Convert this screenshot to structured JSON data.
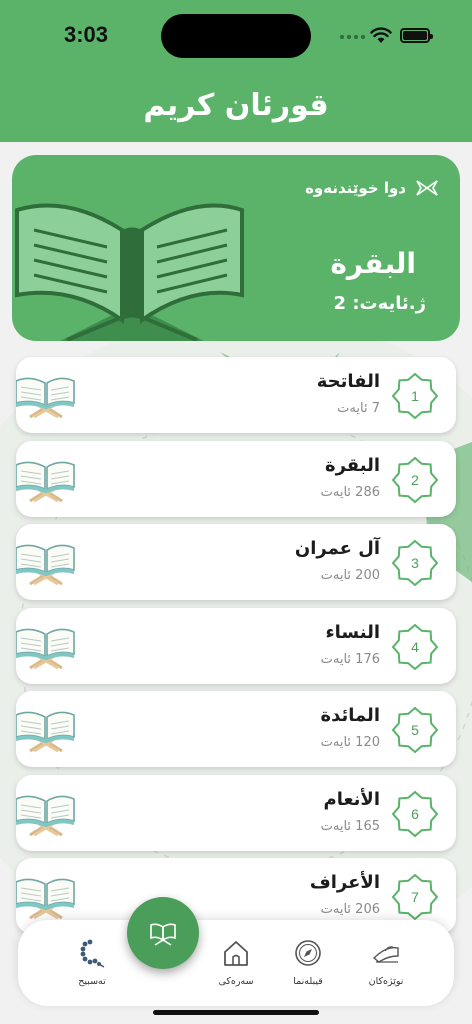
{
  "status": {
    "time": "3:03"
  },
  "header": {
    "title": "قورئان كريم"
  },
  "last_read": {
    "label": "دوا خوێندنەوە",
    "surah": "البقرة",
    "verse": "ژ.ئایەت: 2",
    "icon": "ribbon-icon"
  },
  "surahs": [
    {
      "number": "1",
      "name": "الفاتحة",
      "verses": "7 ئایەت"
    },
    {
      "number": "2",
      "name": "البقرة",
      "verses": "286 ئایەت"
    },
    {
      "number": "3",
      "name": "آل عمران",
      "verses": "200 ئایەت"
    },
    {
      "number": "4",
      "name": "النساء",
      "verses": "176 ئایەت"
    },
    {
      "number": "5",
      "name": "المائدة",
      "verses": "120 ئایەت"
    },
    {
      "number": "6",
      "name": "الأنعام",
      "verses": "165 ئایەت"
    },
    {
      "number": "7",
      "name": "الأعراف",
      "verses": "206 ئایەت"
    }
  ],
  "tabs": {
    "prayer": "نوێژەکان",
    "qibla": "قیبلەنما",
    "home": "سەرەکی",
    "tasbih": "تەسبیح"
  },
  "colors": {
    "primary": "#5bb36a",
    "accent": "#4a9e59"
  }
}
